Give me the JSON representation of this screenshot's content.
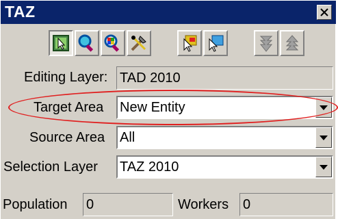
{
  "window": {
    "title": "TAZ",
    "close_glyph": "✕"
  },
  "toolbar": {
    "buttons": [
      {
        "icon": "select-arrow-icon",
        "pressed": true
      },
      {
        "icon": "zoom-in-icon",
        "pressed": false
      },
      {
        "icon": "zoom-extent-icon",
        "pressed": false
      },
      {
        "icon": "tools-icon",
        "pressed": false
      },
      {
        "icon": "pointer-fill-icon",
        "pressed": false
      },
      {
        "icon": "pointer-select-icon",
        "pressed": false
      },
      {
        "icon": "lower-layer-icon",
        "pressed": false
      },
      {
        "icon": "raise-layer-icon",
        "pressed": false
      }
    ]
  },
  "form": {
    "editing_layer_label": "Editing Layer:",
    "editing_layer_value": "TAD 2010",
    "target_area_label": "Target Area",
    "target_area_value": "New Entity",
    "source_area_label": "Source Area",
    "source_area_value": "All",
    "selection_layer_label": "Selection Layer",
    "selection_layer_value": "TAZ 2010",
    "population_label": "Population",
    "population_value": "0",
    "workers_label": "Workers",
    "workers_value": "0"
  },
  "colors": {
    "titlebar": "#0a246a",
    "highlight_ellipse": "#e02020"
  }
}
